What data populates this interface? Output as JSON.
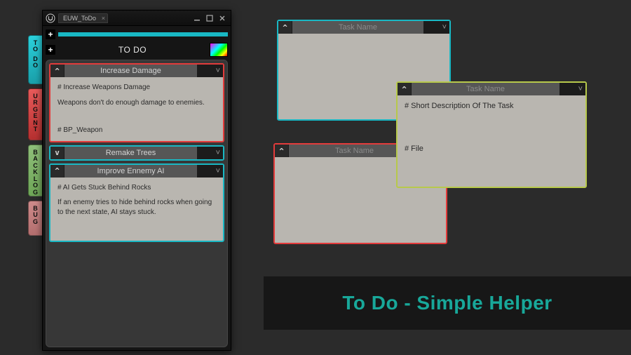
{
  "window": {
    "tab_title": "EUW_ToDo",
    "section_title": "TO DO"
  },
  "side_tabs": [
    {
      "label": "TO DO",
      "class": "cyan"
    },
    {
      "label": "URGENT",
      "class": "red"
    },
    {
      "label": "BACKLOG",
      "class": "green"
    },
    {
      "label": "BUG",
      "class": "pink"
    }
  ],
  "tasks": [
    {
      "name": "Increase Damage",
      "chev": "^",
      "heading": "# Increase Weapons Damage",
      "body": "Weapons don't do enough damage to enemies.",
      "file": "# BP_Weapon",
      "color": "red",
      "collapsed": false
    },
    {
      "name": "Remake Trees",
      "chev": "v",
      "color": "cyan",
      "collapsed": true
    },
    {
      "name": "Improve Ennemy AI",
      "chev": "^",
      "heading": "# AI Gets Stuck Behind Rocks",
      "body": "If an enemy tries to hide behind rocks when going to the next state, AI stays stuck.",
      "file": "",
      "color": "cyan",
      "collapsed": false
    }
  ],
  "examples": {
    "placeholder_name": "Task Name",
    "desc": "# Short Description Of The Task",
    "file": "# File"
  },
  "caption": "To Do - Simple Helper",
  "glyphs": {
    "chev_up": "^",
    "chev_down": "v",
    "drop": "˅"
  }
}
